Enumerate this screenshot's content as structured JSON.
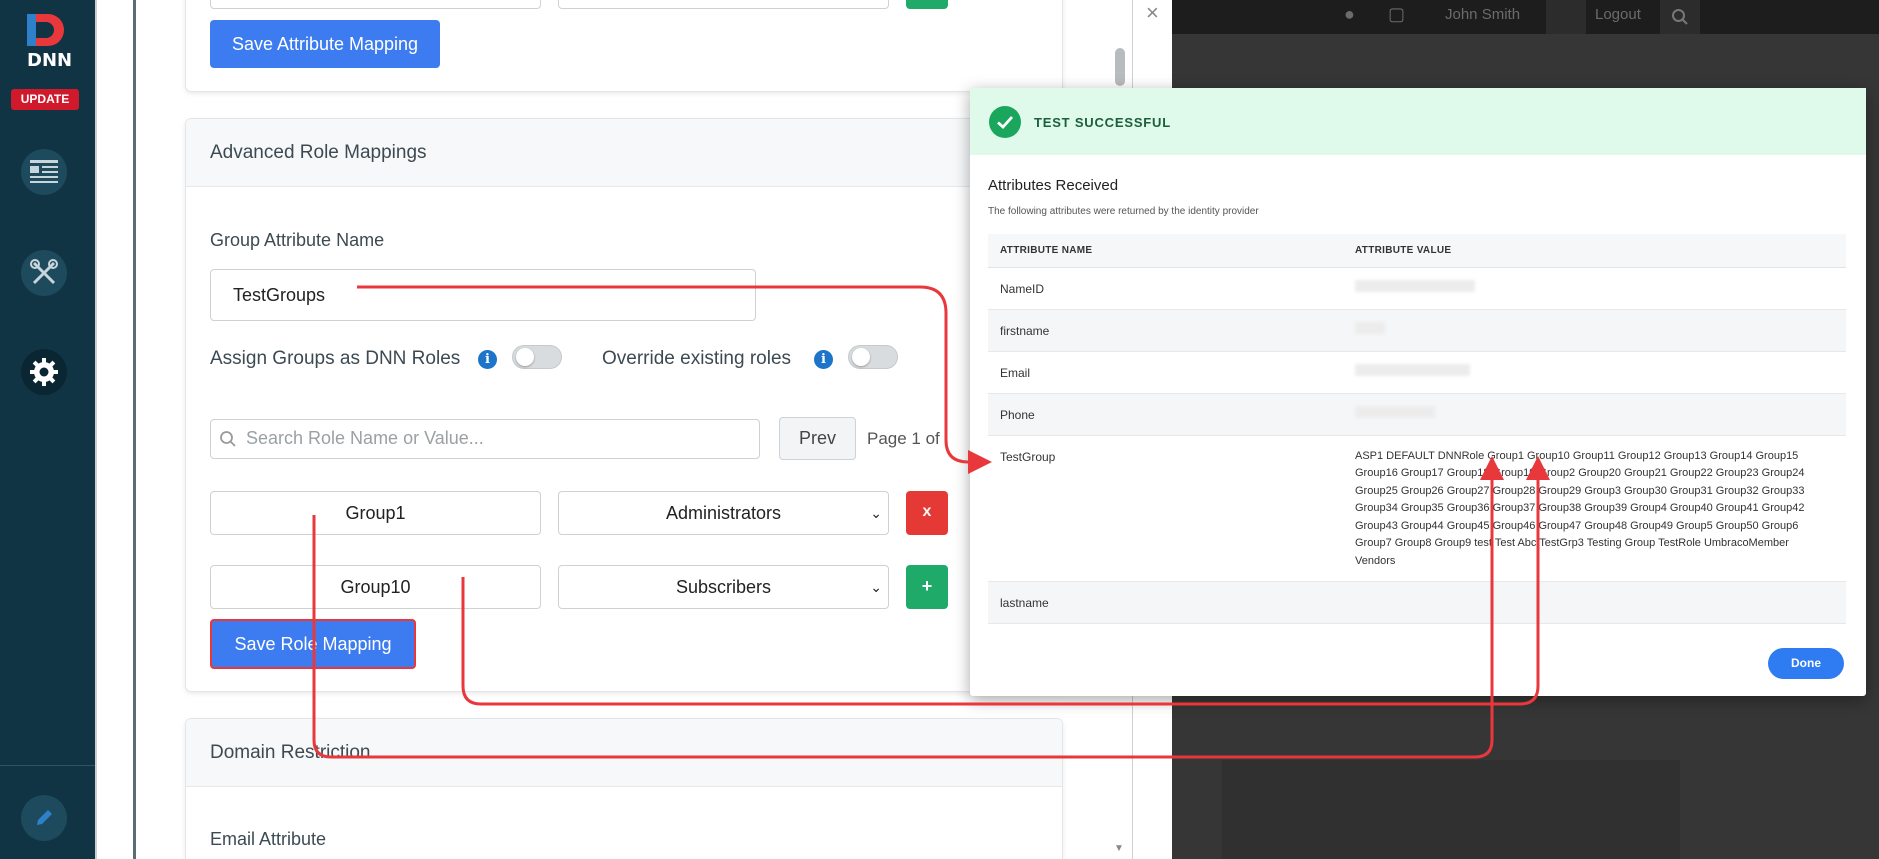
{
  "sidebar": {
    "logo_text": "DNN",
    "update_label": "UPDATE",
    "items": [
      {
        "icon": "content-icon"
      },
      {
        "icon": "tools-icon"
      },
      {
        "icon": "settings-icon"
      }
    ],
    "bottom_icon": "edit-pencil-icon"
  },
  "attribute_mapping": {
    "save_label": "Save Attribute Mapping"
  },
  "role_mappings": {
    "title": "Advanced Role Mappings",
    "group_attr_label": "Group Attribute Name",
    "group_attr_value": "TestGroups",
    "assign_label": "Assign Groups as DNN Roles",
    "override_label": "Override existing roles",
    "search_placeholder": "Search Role Name or Value...",
    "prev_label": "Prev",
    "page_text": "Page 1 of",
    "rows": [
      {
        "group": "Group1",
        "role": "Administrators",
        "action": "x"
      },
      {
        "group": "Group10",
        "role": "Subscribers",
        "action": "+"
      }
    ],
    "save_label": "Save Role Mapping"
  },
  "domain_restriction": {
    "title": "Domain Restriction",
    "email_attr_label": "Email Attribute"
  },
  "top_bar": {
    "user_name": "John Smith",
    "logout_label": "Logout"
  },
  "modal": {
    "close_symbol": "×",
    "status": "TEST SUCCESSFUL",
    "title": "Attributes Received",
    "subtitle": "The following attributes were returned by the identity provider",
    "col_name": "ATTRIBUTE NAME",
    "col_value": "ATTRIBUTE VALUE",
    "rows": [
      {
        "name": "NameID",
        "value": ""
      },
      {
        "name": "firstname",
        "value": ""
      },
      {
        "name": "Email",
        "value": ""
      },
      {
        "name": "Phone",
        "value": ""
      },
      {
        "name": "TestGroup",
        "value": "ASP1 DEFAULT DNNRole Group1 Group10 Group11 Group12 Group13 Group14 Group15 Group16 Group17 Group18 Group19 Group2 Group20 Group21 Group22 Group23 Group24 Group25 Group26 Group27 Group28 Group29 Group3 Group30 Group31 Group32 Group33 Group34 Group35 Group36 Group37 Group38 Group39 Group4 Group40 Group41 Group42 Group43 Group44 Group45 Group46 Group47 Group48 Group49 Group5 Group50 Group6 Group7 Group8 Group9 test Test Abc TestGrp3 Testing Group TestRole UmbracoMember Vendors"
      },
      {
        "name": "lastname",
        "value": ""
      }
    ],
    "done_label": "Done"
  },
  "colors": {
    "sidebar": "#103444",
    "primary_button": "#3d7cf0",
    "success_green": "#1aa65d",
    "annotation_red": "#e8383b"
  }
}
